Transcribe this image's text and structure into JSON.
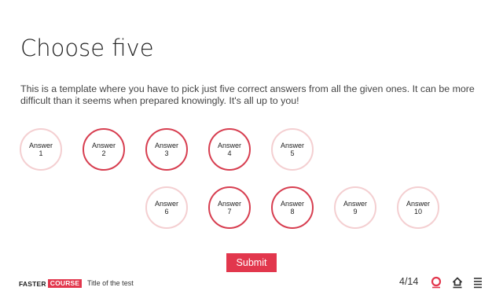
{
  "title": "Choose five",
  "description": "This is a template where you have to pick just five correct answers from all the given ones. It can be more difficult than it seems when prepared knowingly. It's all up to you!",
  "answers": [
    {
      "label": "Answer\n1",
      "selected": false
    },
    {
      "label": "Answer\n2",
      "selected": true
    },
    {
      "label": "Answer\n3",
      "selected": true
    },
    {
      "label": "Answer\n4",
      "selected": true
    },
    {
      "label": "Answer\n5",
      "selected": false
    },
    {
      "label": "Answer\n6",
      "selected": false
    },
    {
      "label": "Answer\n7",
      "selected": true
    },
    {
      "label": "Answer\n8",
      "selected": true
    },
    {
      "label": "Answer\n9",
      "selected": false
    },
    {
      "label": "Answer\n10",
      "selected": false
    }
  ],
  "submit_label": "Submit",
  "footer": {
    "logo_part1": "FASTER",
    "logo_part2": "COURSE",
    "test_title": "Title of the test",
    "page_counter": "4/14",
    "icons": [
      "help-ring-icon",
      "home-icon",
      "menu-icon"
    ]
  },
  "colors": {
    "accent": "#e2374d",
    "selected_border": "#d73e50",
    "unselected_border": "#f4cfd1"
  }
}
